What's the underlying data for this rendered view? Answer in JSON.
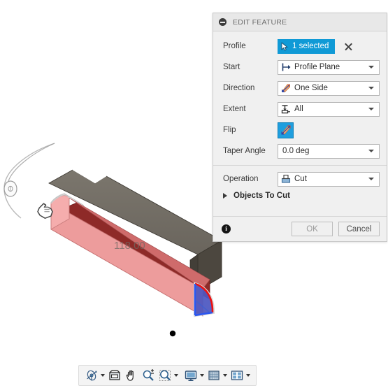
{
  "dialog": {
    "title": "EDIT FEATURE",
    "collapse_icon": "minus-circle-icon",
    "rows": {
      "profile": {
        "label": "Profile",
        "value": "1 selected",
        "icon": "cursor-arrow-icon",
        "clear_icon": "close-x-icon"
      },
      "start": {
        "label": "Start",
        "value": "Profile Plane",
        "icon": "profile-plane-icon"
      },
      "direction": {
        "label": "Direction",
        "value": "One Side",
        "icon": "one-side-arrow-icon"
      },
      "extent": {
        "label": "Extent",
        "value": "All",
        "icon": "extent-all-icon"
      },
      "flip": {
        "label": "Flip",
        "icon": "flip-arrows-icon"
      },
      "taper_angle": {
        "label": "Taper Angle",
        "value": "0.0 deg"
      },
      "operation": {
        "label": "Operation",
        "value": "Cut",
        "icon": "cut-operation-icon"
      }
    },
    "section": {
      "label": "Objects To Cut",
      "expander_icon": "triangle-right-icon",
      "expanded": false
    },
    "footer": {
      "info_icon": "info-circle-icon",
      "info_glyph": "i",
      "ok_label": "OK",
      "cancel_label": "Cancel",
      "ok_enabled": false
    }
  },
  "viewport": {
    "dimension_label": "118.00",
    "navigation_ring": "orbit-ring-icon",
    "cursor": "hand-pointer-cursor",
    "origin_point": "origin-point-marker",
    "colors": {
      "body_top": "#706b63",
      "body_front": "#57534c",
      "body_side": "#4a463f",
      "preview_pink": "#eb9a9a",
      "preview_dark_red": "#8e2a28",
      "profile_blue": "#4b55bd",
      "profile_edge_red": "#e81414",
      "selection_blue": "#2255ee"
    }
  },
  "toolbar": {
    "items": [
      {
        "name": "orbit",
        "icon": "orbit-icon",
        "has_caret": true
      },
      {
        "name": "look-at",
        "icon": "look-at-icon",
        "has_caret": false
      },
      {
        "name": "pan",
        "icon": "pan-hand-icon",
        "has_caret": false
      },
      {
        "name": "zoom",
        "icon": "zoom-plusminus-icon",
        "has_caret": false
      },
      {
        "name": "zoom-window",
        "icon": "zoom-window-icon",
        "has_caret": true
      },
      {
        "name": "display-settings",
        "icon": "monitor-icon",
        "has_caret": true
      },
      {
        "name": "grid-snaps",
        "icon": "grid-icon",
        "has_caret": true
      },
      {
        "name": "viewports",
        "icon": "viewports-icon",
        "has_caret": true
      }
    ]
  }
}
